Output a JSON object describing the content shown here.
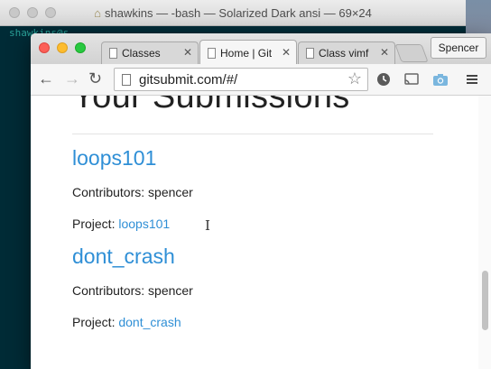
{
  "terminal": {
    "title": "shawkins — -bash — Solarized Dark ansi — 69×24",
    "prompt_fragment": "shawkins@s"
  },
  "browser": {
    "tabs": [
      {
        "label": "Classes",
        "active": false
      },
      {
        "label": "Home | Git",
        "active": true
      },
      {
        "label": "Class vimf",
        "active": false
      }
    ],
    "profile_name": "Spencer",
    "url": "gitsubmit.com/#/",
    "icons": {
      "back": "back-arrow-icon",
      "forward": "forward-arrow-icon",
      "reload": "reload-icon",
      "bookmark": "star-icon",
      "extension1": "clock-icon",
      "extension2": "cast-icon",
      "extension3": "camera-icon",
      "menu": "hamburger-menu-icon"
    }
  },
  "page": {
    "heading": "Your Submissions",
    "submissions": [
      {
        "title": "loops101",
        "contributors_label": "Contributors: spencer",
        "project_label": "Project: ",
        "project_link": "loops101"
      },
      {
        "title": "dont_crash",
        "contributors_label": "Contributors: spencer",
        "project_label": "Project: ",
        "project_link": "dont_crash"
      }
    ]
  },
  "colors": {
    "link": "#2f8fd6",
    "terminal_bg": "#002b36"
  }
}
